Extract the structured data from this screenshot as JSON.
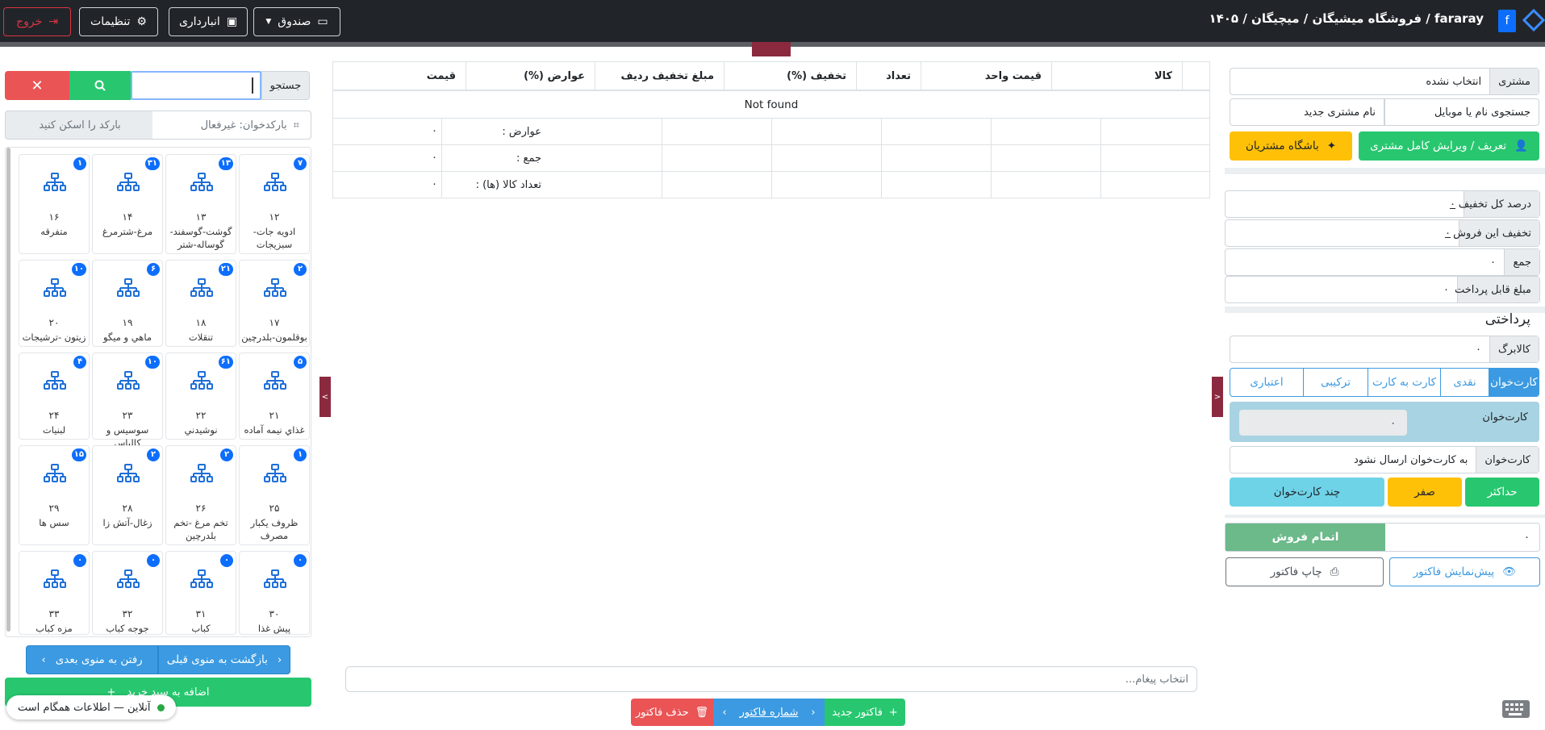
{
  "navbar": {
    "logout": "خروج",
    "settings": "تنظیمات",
    "warehouse": "انبارداری",
    "cashbox": "صندوق",
    "brand": "fararay / فروشگاه میشیگان / میچیگان / ۱۴۰۵",
    "logo_letter": "f"
  },
  "left": {
    "search_label": "جستجو",
    "barcode_status": "بارکدخوان: غیرفعال",
    "barcode_hint": "بارکد را اسکن کنید",
    "tiles": [
      {
        "badge": "۷",
        "num": "۱۲",
        "name": "ادویه جات-سبزیجات"
      },
      {
        "badge": "۱۳",
        "num": "۱۳",
        "name": "گوشت-گوسفند-گوساله-شتر"
      },
      {
        "badge": "۳۱",
        "num": "۱۴",
        "name": "مرغ-شترمرغ"
      },
      {
        "badge": "۱",
        "num": "۱۶",
        "name": "متفرقه"
      },
      {
        "badge": "۲",
        "num": "۱۷",
        "name": "بوقلمون-بلدرچین"
      },
      {
        "badge": "۲۱",
        "num": "۱۸",
        "name": "تنقلات"
      },
      {
        "badge": "۶",
        "num": "۱۹",
        "name": "ماهي و میگو"
      },
      {
        "badge": "۱۰",
        "num": "۲۰",
        "name": "زیتون -ترشیجات"
      },
      {
        "badge": "۵",
        "num": "۲۱",
        "name": "غذاي نیمه آماده"
      },
      {
        "badge": "۶۱",
        "num": "۲۲",
        "name": "نوشیدني"
      },
      {
        "badge": "۱۰",
        "num": "۲۳",
        "name": "سوسیس و کالباس"
      },
      {
        "badge": "۴",
        "num": "۲۴",
        "name": "لبنیات"
      },
      {
        "badge": "۱",
        "num": "۲۵",
        "name": "ظروف یکبار مصرف"
      },
      {
        "badge": "۲",
        "num": "۲۶",
        "name": "تخم مرغ -تخم بلدرچین"
      },
      {
        "badge": "۲",
        "num": "۲۸",
        "name": "زغال-آتش زا"
      },
      {
        "badge": "۱۵",
        "num": "۲۹",
        "name": "سس ها"
      },
      {
        "badge": "۰",
        "num": "۳۰",
        "name": "پیش غذا"
      },
      {
        "badge": "۰",
        "num": "۳۱",
        "name": "کباب"
      },
      {
        "badge": "۰",
        "num": "۳۲",
        "name": "جوجه کباب"
      },
      {
        "badge": "۰",
        "num": "۳۳",
        "name": "مزه کباب"
      }
    ],
    "next_menu": "رفتن به منوی بعدی",
    "prev_menu": "بازگشت به منوی قبلی",
    "add_to_cart": "اضافه به سبد خرید",
    "status": "آنلاین — اطلاعات همگام است"
  },
  "table": {
    "columns": [
      "کالا",
      "قیمت واحد",
      "تعداد",
      "تخفیف (%)",
      "مبلغ تخفیف ردیف",
      "عوارض (%)",
      "قیمت"
    ],
    "empty": "Not found",
    "summary": [
      {
        "label": "عوارض :",
        "value": "۰"
      },
      {
        "label": "جمع :",
        "value": "۰"
      },
      {
        "label": "تعداد کالا (ها) :",
        "value": "۰"
      }
    ]
  },
  "center": {
    "message_placeholder": "انتخاب پیغام...",
    "new_invoice": "فاکتور جدید",
    "invoice_number": "شماره فاکتور",
    "delete_invoice": "حذف فاکتور"
  },
  "right": {
    "customer_label": "مشتری",
    "customer_value": "انتخاب نشده",
    "search_customer": "جستجوی نام یا موبایل",
    "new_customer_name": "نام مشتری جدید",
    "define_customer": "تعریف / ویرایش کامل مشتری",
    "customer_club": "باشگاه مشتریان",
    "total_discount_pct_label": "درصد کل تخفیف",
    "total_discount_pct": "۰",
    "sale_discount_label": "تخفیف این فروش",
    "sale_discount": "۰",
    "sum_label": "جمع",
    "sum": "۰",
    "payable_label": "مبلغ قابل پرداخت",
    "payable": "۰",
    "payment_title": "پرداختی",
    "voucher_label": "کالابرگ",
    "voucher_value": "۰",
    "pay_tabs": [
      "کارت‌خوان",
      "نقدی",
      "کارت به کارت",
      "ترکیبی",
      "اعتباری"
    ],
    "card_reader_label": "کارت‌خوان",
    "card_reader_amount": "۰",
    "card_reader_select_label": "کارت‌خوان",
    "card_reader_select_value": "به کارت‌خوان ارسال نشود",
    "max_btn": "حداکثر",
    "zero_btn": "صفر",
    "multi_reader_btn": "چند کارت‌خوان",
    "complete_sale": "اتمام فروش",
    "complete_amount": "۰",
    "preview_invoice": "پیش‌نمایش فاکتور",
    "print_invoice": "چاپ فاکتور"
  },
  "colors": {
    "navbar": "#212529",
    "success": "#28c76f",
    "danger": "#ea5455",
    "warning": "#ffc107",
    "info": "#6fd3e8",
    "primary": "#3b9ae1",
    "accent": "#8b2a3f"
  }
}
